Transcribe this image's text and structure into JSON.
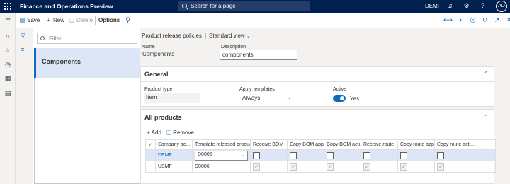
{
  "topbar": {
    "app_title": "Finance and Operations Preview",
    "search_placeholder": "Search for a page",
    "company": "DEMF",
    "user_initials": "AD"
  },
  "actionbar": {
    "save": "Save",
    "new": "New",
    "delete": "Delete",
    "options": "Options"
  },
  "filterpane": {
    "filter_placeholder": "Filter",
    "items": [
      {
        "label": "Components",
        "selected": true
      }
    ]
  },
  "breadcrumb": {
    "page": "Product release policies",
    "view": "Standard view"
  },
  "header_fields": {
    "name_label": "Name",
    "name_value": "Components",
    "description_label": "Description",
    "description_value": "components"
  },
  "general": {
    "title": "General",
    "product_type_label": "Product type",
    "product_type_value": "Item",
    "apply_templates_label": "Apply templates",
    "apply_templates_value": "Always",
    "active_label": "Active",
    "active_value": "Yes"
  },
  "all_products": {
    "title": "All products",
    "add": "Add",
    "remove": "Remove",
    "columns": [
      "Company ac...",
      "Template released product",
      "Receive BOM",
      "Copy BOM app...",
      "Copy BOM acti...",
      "Receive route",
      "Copy route app...",
      "Copy route acti..."
    ],
    "rows": [
      {
        "company": "DEMF",
        "template": "D0006",
        "selected": true
      },
      {
        "company": "USMF",
        "template": "D0006",
        "selected": false
      }
    ]
  },
  "colors": {
    "topbar": "#002050",
    "accent": "#0f6cbd",
    "selection": "#dce6f7"
  }
}
